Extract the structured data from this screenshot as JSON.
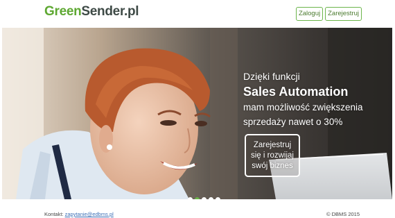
{
  "brand": {
    "part1": "Green",
    "part2": "Sender.pl"
  },
  "auth": {
    "login_label": "Zaloguj",
    "register_label": "Zarejestruj"
  },
  "hero": {
    "line1": "Dzięki funkcji",
    "line2": "Sales Automation",
    "line3": "mam możliwość zwiększenia",
    "line4": "sprzedaży nawet o 30%",
    "cta_label": "Zarejestruj się i rozwijaj swój biznes",
    "slides": 5,
    "active_slide": 2
  },
  "footer": {
    "contact_label": "Kontakt:",
    "contact_email": "zapytanie@edbms.pl",
    "copyright": "© DBMS 2015"
  },
  "colors": {
    "brand_green": "#5ea832",
    "brand_dark": "#3e4a46",
    "link": "#3b6fb6"
  }
}
